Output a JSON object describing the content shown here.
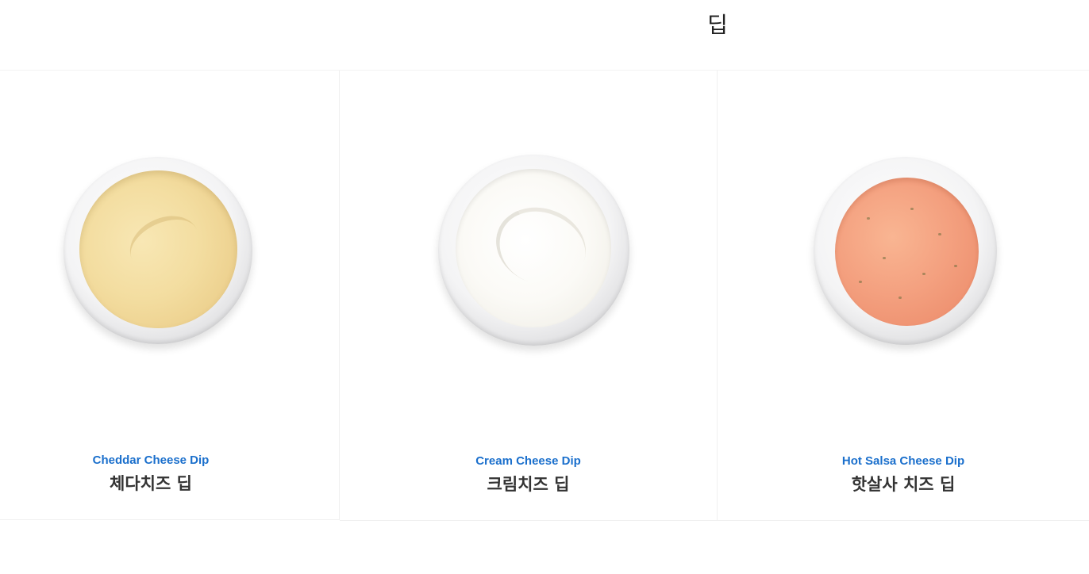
{
  "section": {
    "title": "딥"
  },
  "products": [
    {
      "name_en": "Cheddar Cheese Dip",
      "name_ko": "체다치즈 딥",
      "dip_color": "#f3dda0"
    },
    {
      "name_en": "Cream Cheese Dip",
      "name_ko": "크림치즈 딥",
      "dip_color": "#fbfaf6"
    },
    {
      "name_en": "Hot Salsa Cheese Dip",
      "name_ko": "핫살사 치즈 딥",
      "dip_color": "#f4a180"
    }
  ],
  "colors": {
    "accent_text": "#1a6fcc",
    "title_text": "#333333",
    "divider": "#f0f0f0"
  }
}
